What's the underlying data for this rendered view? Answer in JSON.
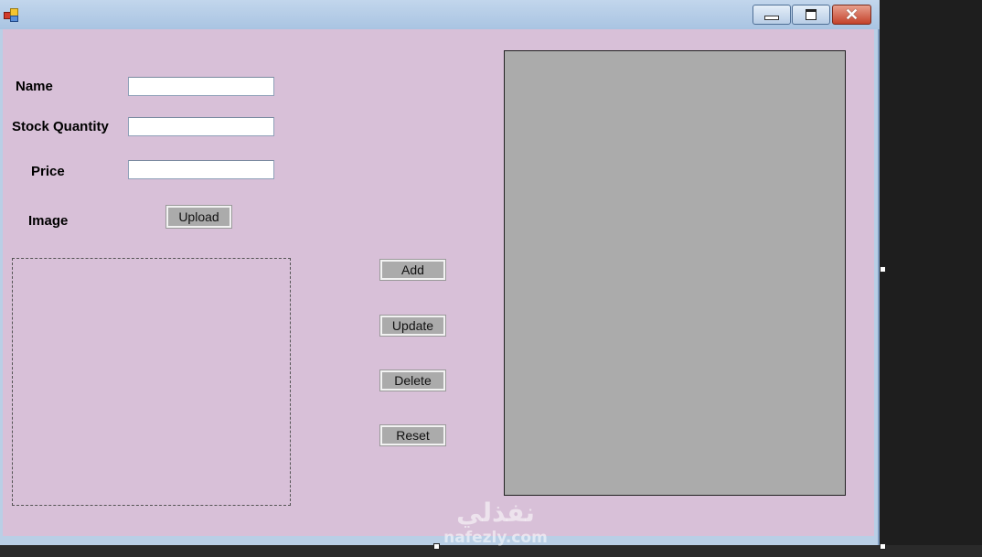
{
  "window": {
    "title": "",
    "title_buttons": {
      "minimize": "minimize",
      "maximize": "maximize",
      "close": "✕"
    }
  },
  "form": {
    "name_label": "Name",
    "stock_label": "Stock Quantity",
    "price_label": "Price",
    "image_label": "Image",
    "name_value": "",
    "stock_value": "",
    "price_value": "",
    "upload_label": "Upload"
  },
  "actions": {
    "add_label": "Add",
    "update_label": "Update",
    "delete_label": "Delete",
    "reset_label": "Reset"
  },
  "watermark": {
    "arabic": "نفذلي",
    "latin": "nafezly.com"
  },
  "colors": {
    "client_background": "#d8c0d8",
    "button_face": "#ababab",
    "grid_background": "#ababab"
  }
}
